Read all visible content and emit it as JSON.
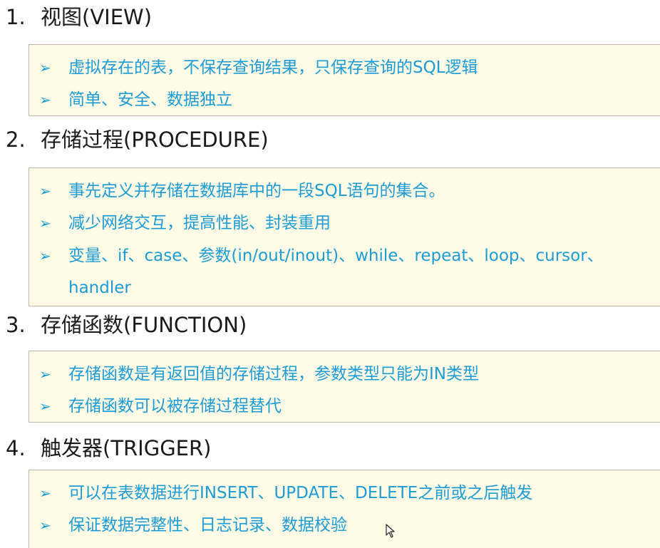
{
  "sections": [
    {
      "number": "1.",
      "title": "视图(VIEW)",
      "items": [
        "虚拟存在的表，不保存查询结果，只保存查询的SQL逻辑",
        "简单、安全、数据独立"
      ]
    },
    {
      "number": "2.",
      "title": "存储过程(PROCEDURE)",
      "items": [
        "事先定义并存储在数据库中的一段SQL语句的集合。",
        "减少网络交互，提高性能、封装重用",
        "变量、if、case、参数(in/out/inout)、while、repeat、loop、cursor、",
        "handler"
      ]
    },
    {
      "number": "3.",
      "title": "存储函数(FUNCTION)",
      "items": [
        "存储函数是有返回值的存储过程，参数类型只能为IN类型",
        "存储函数可以被存储过程替代"
      ]
    },
    {
      "number": "4.",
      "title": "触发器(TRIGGER)",
      "items": [
        "可以在表数据进行INSERT、UPDATE、DELETE之前或之后触发",
        "保证数据完整性、日志记录、数据校验"
      ]
    }
  ],
  "bullet_glyph": "➢",
  "colors": {
    "item_text": "#1d9bd7",
    "box_bg": "#fffbe6",
    "box_border": "#b9b5a8",
    "heading_text": "#1a1a1a"
  },
  "icons": {
    "cursor": "mouse-pointer-icon"
  }
}
